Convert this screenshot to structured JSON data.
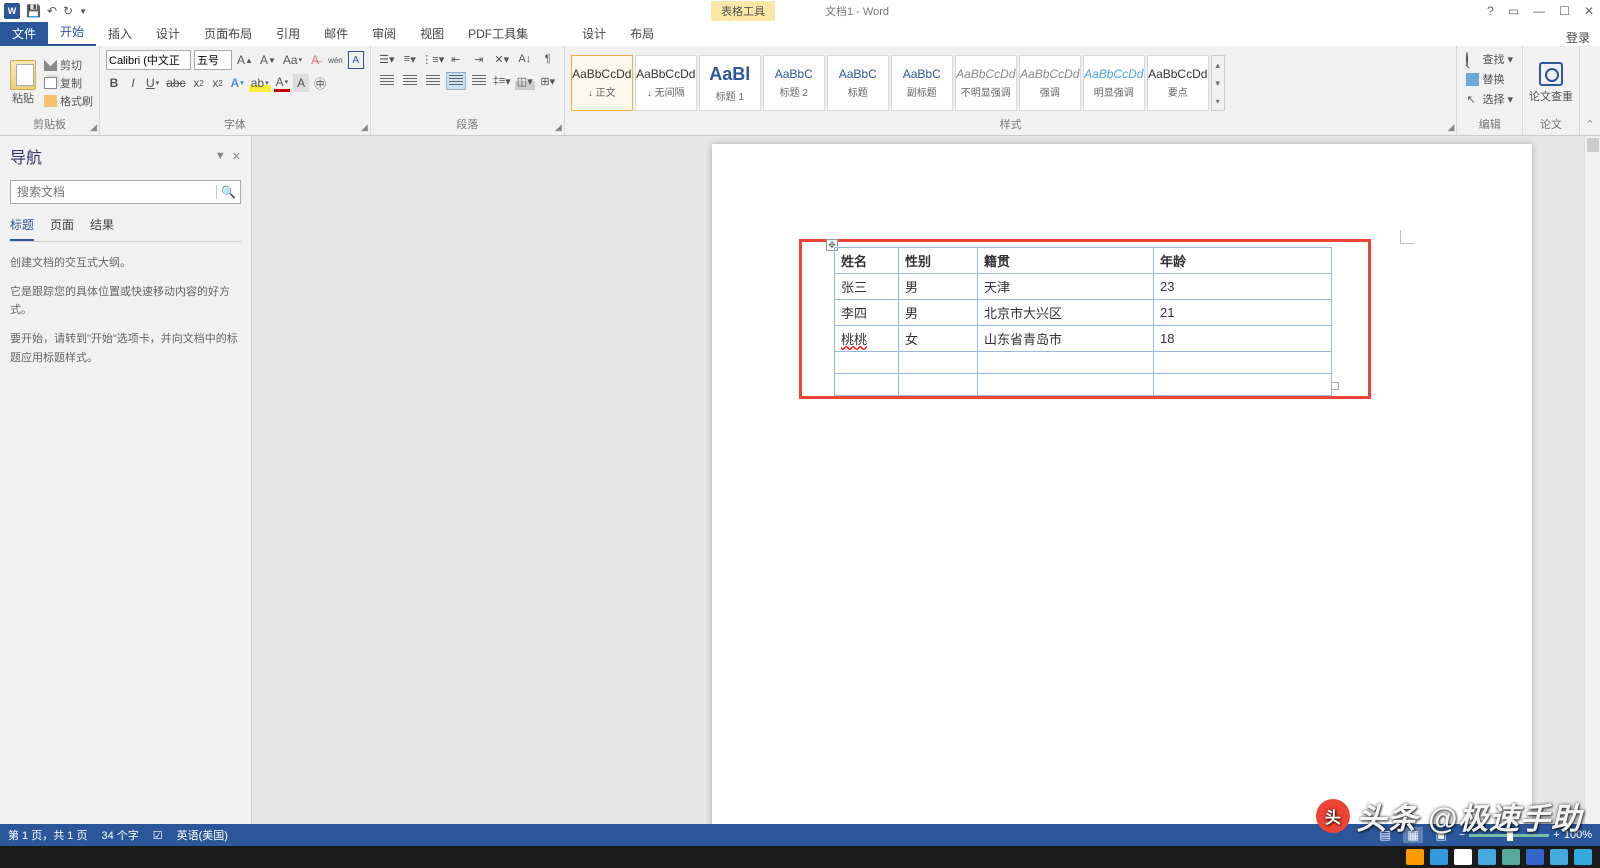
{
  "titlebar": {
    "tool_tab": "表格工具",
    "doc_title": "文档1 - Word",
    "help": "?",
    "login": "登录"
  },
  "tabs": {
    "file": "文件",
    "home": "开始",
    "insert": "插入",
    "design": "设计",
    "layout": "页面布局",
    "references": "引用",
    "mailings": "邮件",
    "review": "审阅",
    "view": "视图",
    "pdf": "PDF工具集",
    "tool_design": "设计",
    "tool_layout": "布局"
  },
  "ribbon": {
    "clipboard": {
      "label": "剪贴板",
      "paste": "粘贴",
      "cut": "剪切",
      "copy": "复制",
      "painter": "格式刷"
    },
    "font": {
      "label": "字体",
      "name": "Calibri (中文正",
      "size": "五号"
    },
    "paragraph": {
      "label": "段落"
    },
    "styles": {
      "label": "样式",
      "items": [
        {
          "prev": "AaBbCcDd",
          "name": "↓ 正文",
          "cls": ""
        },
        {
          "prev": "AaBbCcDd",
          "name": "↓ 无间隔",
          "cls": ""
        },
        {
          "prev": "AaBl",
          "name": "标题 1",
          "cls": "bold"
        },
        {
          "prev": "AaBbC",
          "name": "标题 2",
          "cls": "blue"
        },
        {
          "prev": "AaBbC",
          "name": "标题",
          "cls": "blue"
        },
        {
          "prev": "AaBbC",
          "name": "副标题",
          "cls": "blue"
        },
        {
          "prev": "AaBbCcDd",
          "name": "不明显强调",
          "cls": "ital"
        },
        {
          "prev": "AaBbCcDd",
          "name": "强调",
          "cls": "ital"
        },
        {
          "prev": "AaBbCcDd",
          "name": "明显强调",
          "cls": "link"
        },
        {
          "prev": "AaBbCcDd",
          "name": "要点",
          "cls": ""
        }
      ]
    },
    "editing": {
      "label": "编辑",
      "find": "查找",
      "replace": "替换",
      "select": "选择"
    },
    "thesis": {
      "label": "论文",
      "check": "论文查重"
    }
  },
  "nav": {
    "title": "导航",
    "search_placeholder": "搜索文档",
    "tabs": {
      "headings": "标题",
      "pages": "页面",
      "results": "结果"
    },
    "help1": "创建文档的交互式大纲。",
    "help2": "它是跟踪您的具体位置或快速移动内容的好方式。",
    "help3": "要开始，请转到\"开始\"选项卡，并向文档中的标题应用标题样式。"
  },
  "table": {
    "headers": [
      "姓名",
      "性别",
      "籍贯",
      "年龄"
    ],
    "rows": [
      [
        "张三",
        "男",
        "天津",
        "23"
      ],
      [
        "李四",
        "男",
        "北京市大兴区",
        "21"
      ],
      [
        "桃桃",
        "女",
        "山东省青岛市",
        "18"
      ],
      [
        "",
        "",
        "",
        ""
      ],
      [
        "",
        "",
        "",
        ""
      ]
    ]
  },
  "statusbar": {
    "page": "第 1 页，共 1 页",
    "words": "34 个字",
    "lang": "英语(美国)",
    "zoom": "100%"
  },
  "watermark": "头条 @极速手助"
}
